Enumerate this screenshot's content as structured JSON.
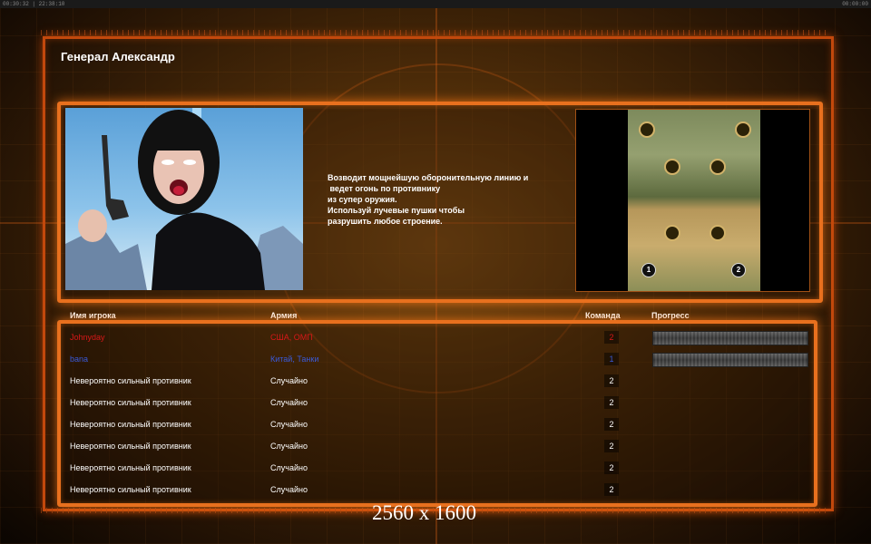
{
  "topbar": {
    "left_text": "00:30:32 | 22:38:10",
    "right_text": "00:00:00"
  },
  "general_title": "Генерал Александр",
  "description_lines": [
    "Возводит мощнейшую оборонительную линию и",
    " ведет огонь по противнику",
    "из супер оружия.",
    "Используй лучевые пушки чтобы",
    "разрушить любое строение."
  ],
  "map": {
    "start_positions": [
      "1",
      "2"
    ]
  },
  "table": {
    "headers": {
      "player": "Имя игрока",
      "army": "Армия",
      "team": "Команда",
      "progress": "Прогресс"
    },
    "rows": [
      {
        "name": "Johnyday",
        "army": "США, ОМП",
        "team": "2",
        "color": "#d81818",
        "progress": 1.0
      },
      {
        "name": "bana",
        "army": "Китай, Танки",
        "team": "1",
        "color": "#3a5ad8",
        "progress": 1.0
      },
      {
        "name": "Невероятно сильный противник",
        "army": "Случайно",
        "team": "2",
        "color": "#ffffff"
      },
      {
        "name": "Невероятно сильный противник",
        "army": "Случайно",
        "team": "2",
        "color": "#ffffff"
      },
      {
        "name": "Невероятно сильный противник",
        "army": "Случайно",
        "team": "2",
        "color": "#ffffff"
      },
      {
        "name": "Невероятно сильный противник",
        "army": "Случайно",
        "team": "2",
        "color": "#ffffff"
      },
      {
        "name": "Невероятно сильный противник",
        "army": "Случайно",
        "team": "2",
        "color": "#ffffff"
      },
      {
        "name": "Невероятно сильный противник",
        "army": "Случайно",
        "team": "2",
        "color": "#ffffff"
      }
    ]
  },
  "watermark": "2560 x 1600",
  "colors": {
    "frame_orange": "#e8701e",
    "player_red": "#d81818",
    "player_blue": "#3a5ad8"
  }
}
